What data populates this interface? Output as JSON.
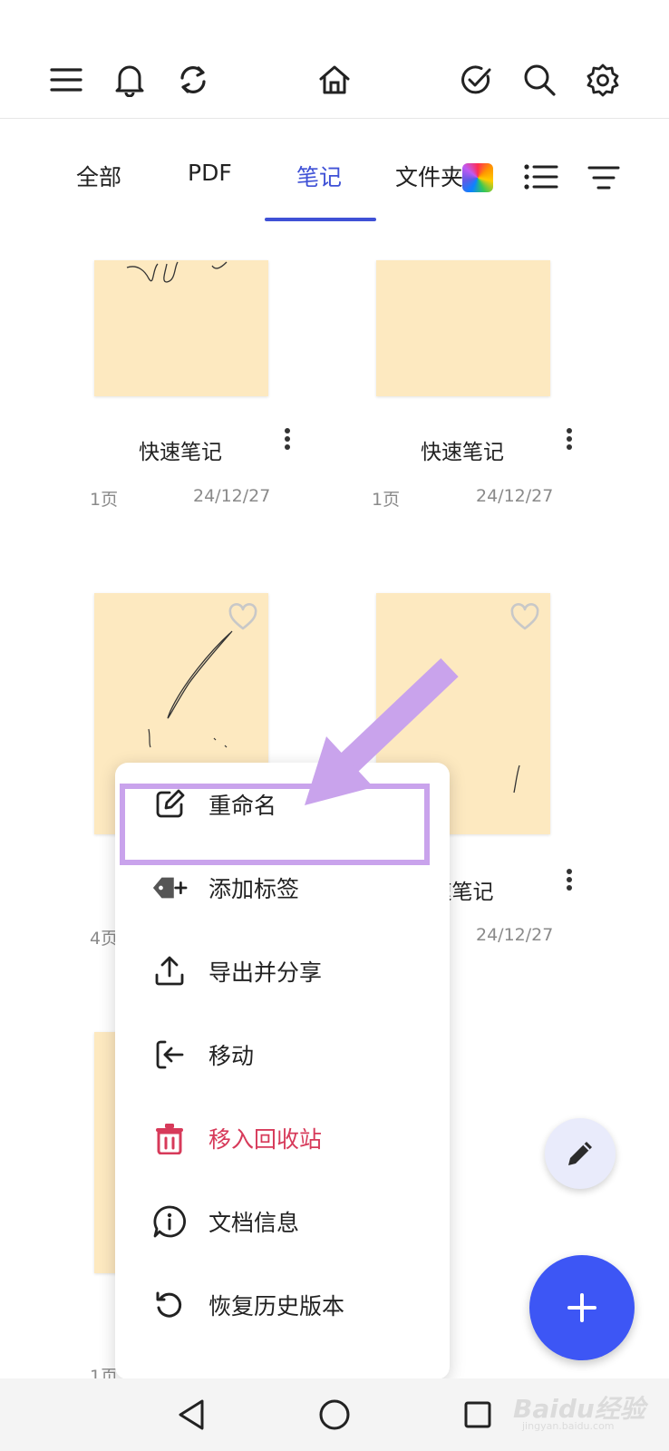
{
  "toolbar": {
    "icons": [
      "menu-icon",
      "bell-icon",
      "sync-icon",
      "home-icon",
      "check-circle-icon",
      "search-icon",
      "gear-icon"
    ]
  },
  "tabs": [
    {
      "label": "全部",
      "active": false
    },
    {
      "label": "PDF",
      "active": false
    },
    {
      "label": "笔记",
      "active": true
    },
    {
      "label": "文件夹",
      "active": false
    }
  ],
  "colors": {
    "accent": "#3f51d6",
    "note_bg": "#fde9c0",
    "danger": "#d73a5a",
    "fab": "#3d56f5",
    "highlight": "#c9a3ec"
  },
  "notes": [
    {
      "title": "快速笔记",
      "pages": "1页",
      "date": "24/12/27"
    },
    {
      "title": "快速笔记",
      "pages": "1页",
      "date": "24/12/27"
    },
    {
      "title": "",
      "pages": "4页",
      "date": ""
    },
    {
      "title": "速笔记",
      "pages": "",
      "date": "24/12/27"
    },
    {
      "title": "",
      "pages": "1页",
      "date": ""
    }
  ],
  "context_menu": {
    "items": [
      {
        "label": "重命名",
        "icon": "edit-icon"
      },
      {
        "label": "添加标签",
        "icon": "tag-add-icon"
      },
      {
        "label": "导出并分享",
        "icon": "export-share-icon"
      },
      {
        "label": "移动",
        "icon": "move-icon"
      },
      {
        "label": "移入回收站",
        "icon": "trash-icon"
      },
      {
        "label": "文档信息",
        "icon": "info-icon"
      },
      {
        "label": "恢复历史版本",
        "icon": "history-icon"
      }
    ]
  },
  "watermark": {
    "text": "Baidu经验",
    "sub": "jingyan.baidu.com"
  }
}
